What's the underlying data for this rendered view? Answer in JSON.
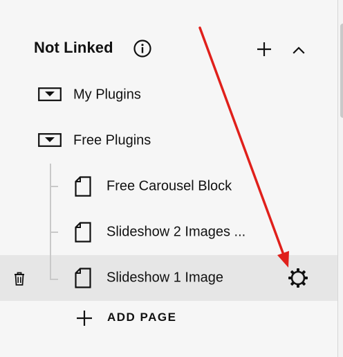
{
  "section": {
    "title": "Not Linked",
    "info_icon": "info-circle-icon",
    "add_icon": "plus-icon",
    "collapse_icon": "chevron-up-icon"
  },
  "items": [
    {
      "label": "My Plugins",
      "type": "folder",
      "icon": "folder-icon"
    },
    {
      "label": "Free Plugins",
      "type": "folder",
      "icon": "folder-icon"
    },
    {
      "label": "Free Carousel Block",
      "type": "page",
      "icon": "page-icon"
    },
    {
      "label": "Slideshow 2 Images ...",
      "type": "page",
      "icon": "page-icon"
    },
    {
      "label": "Slideshow 1 Image",
      "type": "page",
      "icon": "page-icon",
      "selected": true,
      "actions": [
        "trash-icon",
        "gear-icon"
      ]
    }
  ],
  "add_page": {
    "label": "ADD PAGE",
    "icon": "plus-icon"
  },
  "colors": {
    "background": "#f6f6f6",
    "selected_row": "#e6e6e6",
    "tree_line": "#c9c9c9",
    "annotation_arrow": "#e0201b"
  }
}
